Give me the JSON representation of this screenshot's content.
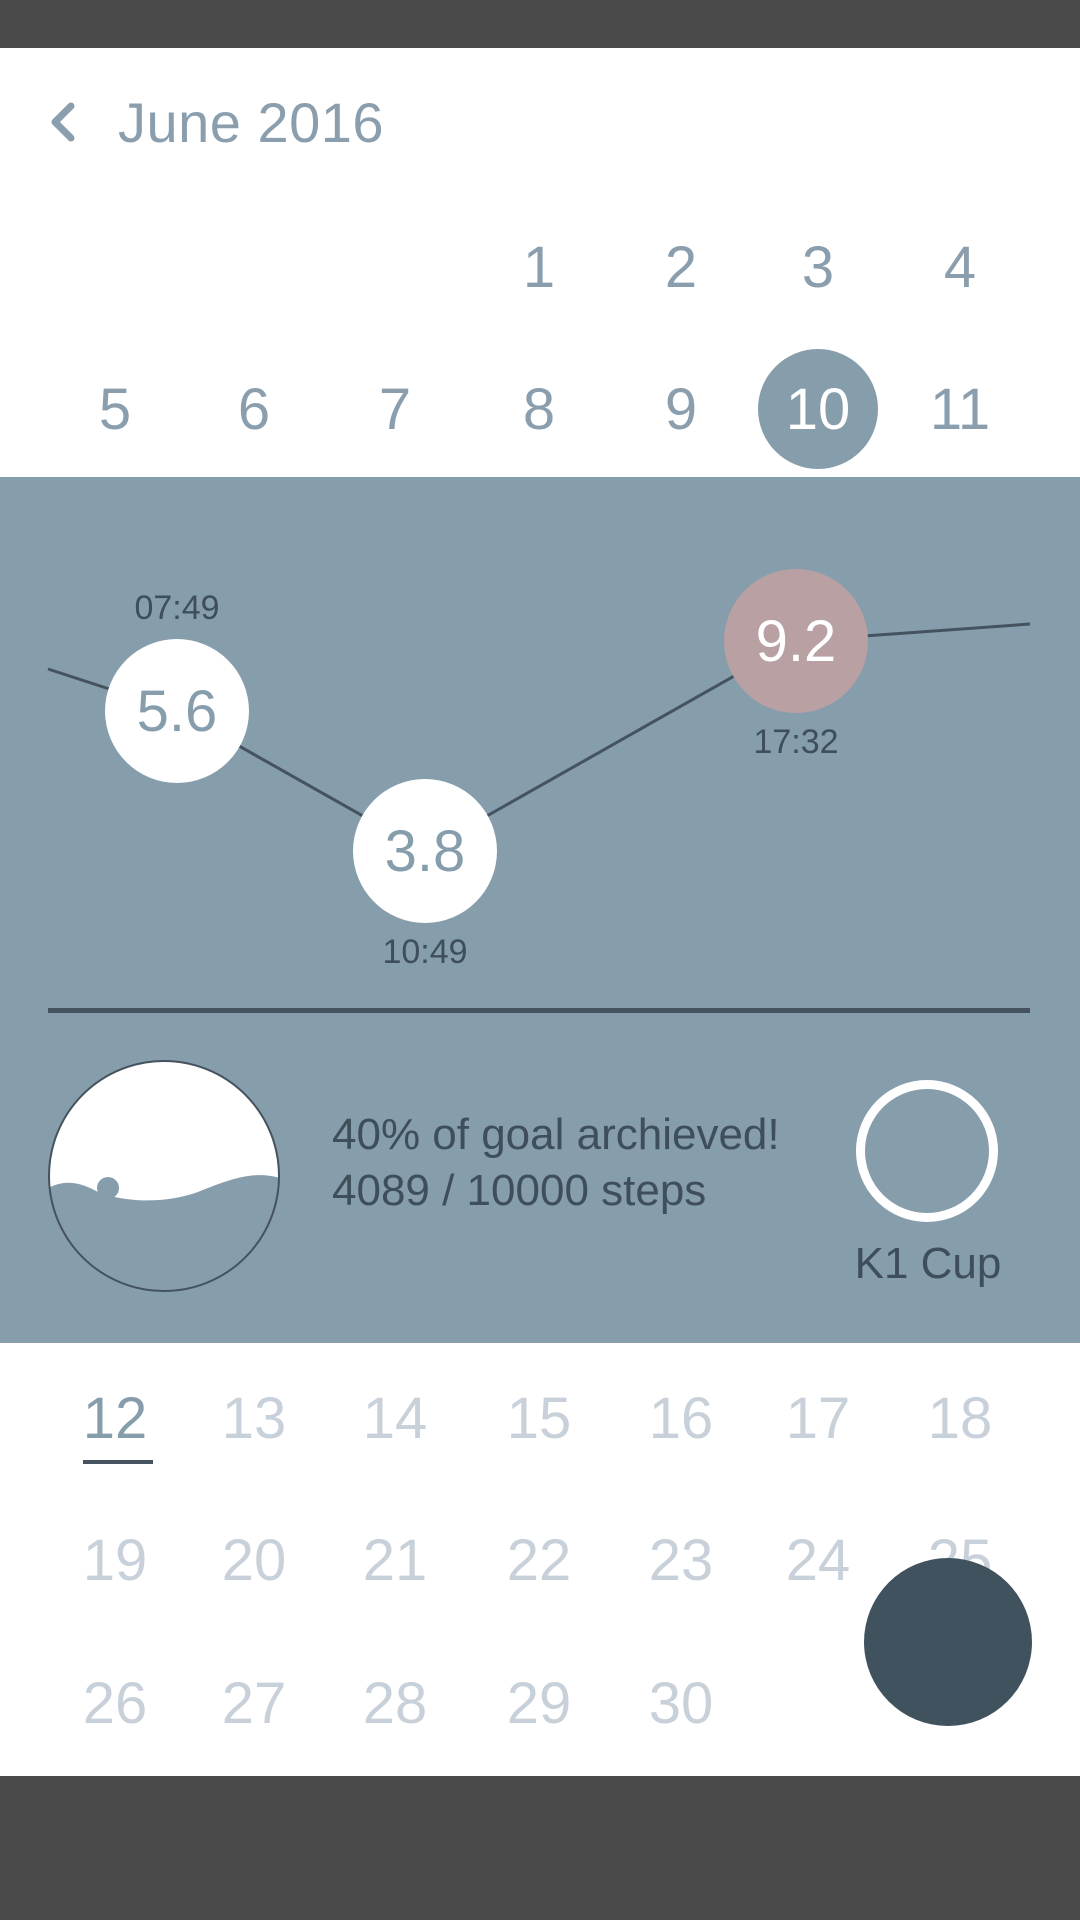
{
  "header": {
    "month_title": "June 2016"
  },
  "calendar": {
    "week1": [
      "1",
      "2",
      "3",
      "4"
    ],
    "week2": [
      "5",
      "6",
      "7",
      "8",
      "9",
      "10",
      "11"
    ],
    "selected_day": "10",
    "week3": [
      "12",
      "13",
      "14",
      "15",
      "16",
      "17",
      "18"
    ],
    "today": "12",
    "week4": [
      "19",
      "20",
      "21",
      "22",
      "23",
      "24",
      "25"
    ],
    "week5": [
      "26",
      "27",
      "28",
      "29",
      "30"
    ]
  },
  "chart_data": {
    "type": "line",
    "points": [
      {
        "value": "5.6",
        "time": "07:49"
      },
      {
        "value": "3.8",
        "time": "10:49"
      },
      {
        "value": "9.2",
        "time": "17:32",
        "highlight": true
      }
    ]
  },
  "activity": {
    "goal_line": "40% of goal archieved!",
    "steps_line": "4089 / 10000 steps",
    "progress_fraction": 0.4
  },
  "cup": {
    "label": "K1 Cup"
  },
  "colors": {
    "panel": "#869dab",
    "dark": "#44535f",
    "highlight": "#b9a0a3",
    "fab": "#41525f"
  }
}
